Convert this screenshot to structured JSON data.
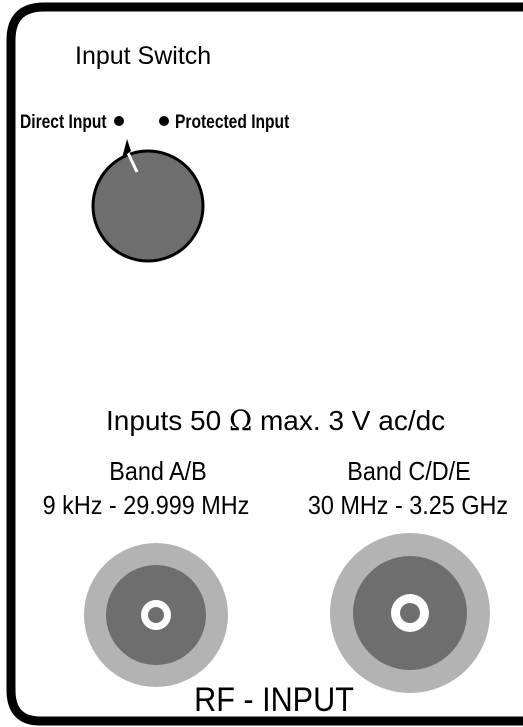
{
  "switch": {
    "title": "Input Switch",
    "left_position": "Direct Input",
    "right_position": "Protected Input"
  },
  "inputs": {
    "spec_prefix": "Inputs 50",
    "ohm_symbol": "Ω",
    "spec_suffix": "max. 3 V ac/dc",
    "band_ab": {
      "label": "Band A/B",
      "range": "9 kHz - 29.999 MHz"
    },
    "band_cde": {
      "label": "Band C/D/E",
      "range": "30 MHz - 3.25 GHz"
    },
    "footer": "RF - INPUT"
  },
  "colors": {
    "border": "#000000",
    "knob": "#6e6e6e",
    "connector_outer": "#b3b3b3",
    "connector_inner": "#6e6e6e"
  }
}
